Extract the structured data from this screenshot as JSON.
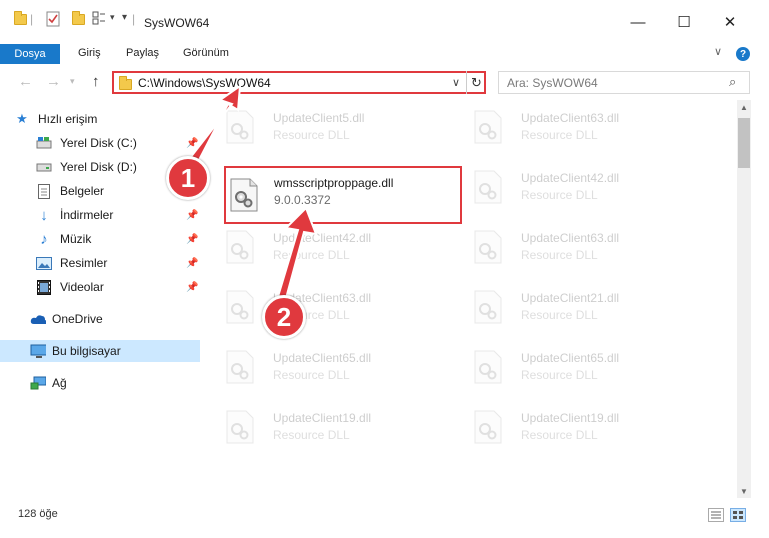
{
  "window": {
    "title": "SysWOW64",
    "minimize_glyph": "—",
    "maximize_glyph": "☐",
    "close_glyph": "✕"
  },
  "ribbon": {
    "tabs": [
      "Dosya",
      "Giriş",
      "Paylaş",
      "Görünüm"
    ],
    "help_glyph": "?",
    "accent": "#1979ca"
  },
  "navigation": {
    "back_glyph": "←",
    "forward_glyph": "→",
    "up_glyph": "↑",
    "address": "C:\\Windows\\SysWOW64",
    "refresh_glyph": "↻",
    "search_placeholder": "Ara: SysWOW64",
    "search_glyph": "⌕"
  },
  "sidebar": {
    "items": [
      {
        "label": "Hızlı erişim",
        "icon": "star-icon",
        "pinned": false,
        "selected": false
      },
      {
        "label": "Yerel Disk (C:)",
        "icon": "drive-icon",
        "pinned": true,
        "selected": false
      },
      {
        "label": "Yerel Disk (D:)",
        "icon": "drive-icon",
        "pinned": true,
        "selected": false
      },
      {
        "label": "Belgeler",
        "icon": "document-icon",
        "pinned": true,
        "selected": false
      },
      {
        "label": "İndirmeler",
        "icon": "download-icon",
        "pinned": true,
        "selected": false
      },
      {
        "label": "Müzik",
        "icon": "music-icon",
        "pinned": true,
        "selected": false
      },
      {
        "label": "Resimler",
        "icon": "pictures-icon",
        "pinned": true,
        "selected": false
      },
      {
        "label": "Videolar",
        "icon": "video-icon",
        "pinned": true,
        "selected": false
      },
      {
        "label": "OneDrive",
        "icon": "cloud-icon",
        "pinned": false,
        "selected": false
      },
      {
        "label": "Bu bilgisayar",
        "icon": "computer-icon",
        "pinned": false,
        "selected": true
      },
      {
        "label": "Ağ",
        "icon": "network-icon",
        "pinned": false,
        "selected": false
      }
    ]
  },
  "files": {
    "faded_left": [
      {
        "name": "UpdateClient5.dll",
        "sub": "Resource DLL"
      },
      {
        "name": "UpdateClient42.dll",
        "sub": "Resource DLL"
      },
      {
        "name": "UpdateClient63.dll",
        "sub": "Resource DLL"
      },
      {
        "name": "UpdateClient65.dll",
        "sub": "Resource DLL"
      },
      {
        "name": "UpdateClient19.dll",
        "sub": "Resource DLL"
      }
    ],
    "faded_right": [
      {
        "name": "UpdateClient63.dll",
        "sub": "Resource DLL"
      },
      {
        "name": "UpdateClient42.dll",
        "sub": "Resource DLL"
      },
      {
        "name": "UpdateClient63.dll",
        "sub": "Resource DLL"
      },
      {
        "name": "UpdateClient21.dll",
        "sub": "Resource DLL"
      },
      {
        "name": "UpdateClient65.dll",
        "sub": "Resource DLL"
      },
      {
        "name": "UpdateClient19.dll",
        "sub": "Resource DLL"
      }
    ],
    "highlighted": {
      "name": "wmsscriptproppage.dll",
      "version": "9.0.0.3372"
    }
  },
  "status": {
    "item_count": "128 öğe"
  },
  "annotations": {
    "badge_1": "1",
    "badge_2": "2",
    "color": "#e0393e"
  }
}
